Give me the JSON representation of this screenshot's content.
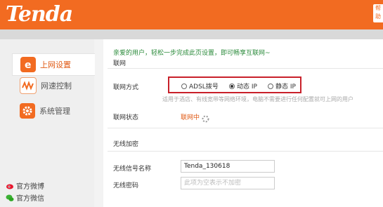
{
  "header": {
    "logo": "Tenda",
    "top_button": "帮助"
  },
  "sidebar": {
    "items": [
      {
        "label": "上网设置",
        "icon": "internet-e-icon",
        "active": true
      },
      {
        "label": "网速控制",
        "icon": "speed-wave-icon",
        "active": false
      },
      {
        "label": "系统管理",
        "icon": "system-gear-icon",
        "active": false
      }
    ],
    "social": [
      {
        "label": "官方微博",
        "icon": "weibo-icon"
      },
      {
        "label": "官方微信",
        "icon": "wechat-icon"
      }
    ]
  },
  "main": {
    "welcome": "亲爱的用户，轻松一步完成此页设置，即可畅享互联网~",
    "section_internet": "联网",
    "connection_label": "联网方式",
    "connection_options": [
      "ADSL拨号",
      "动态 IP",
      "静态 IP"
    ],
    "connection_selected": "动态 IP",
    "connection_hint": "适用于酒店、有线宽带等网络环境，电脑不需要进行任何配置就可上网的用户",
    "status_label": "联网状态",
    "status_value": "联网中",
    "section_wireless": "无线加密",
    "ssid_label": "无线信号名称",
    "ssid_value": "Tenda_130618",
    "password_label": "无线密码",
    "password_placeholder": "此项为空表示不加密"
  },
  "colors": {
    "brand": "#f26b21",
    "highlight_box": "#c8202a",
    "hint_text": "#2a8a3a"
  }
}
